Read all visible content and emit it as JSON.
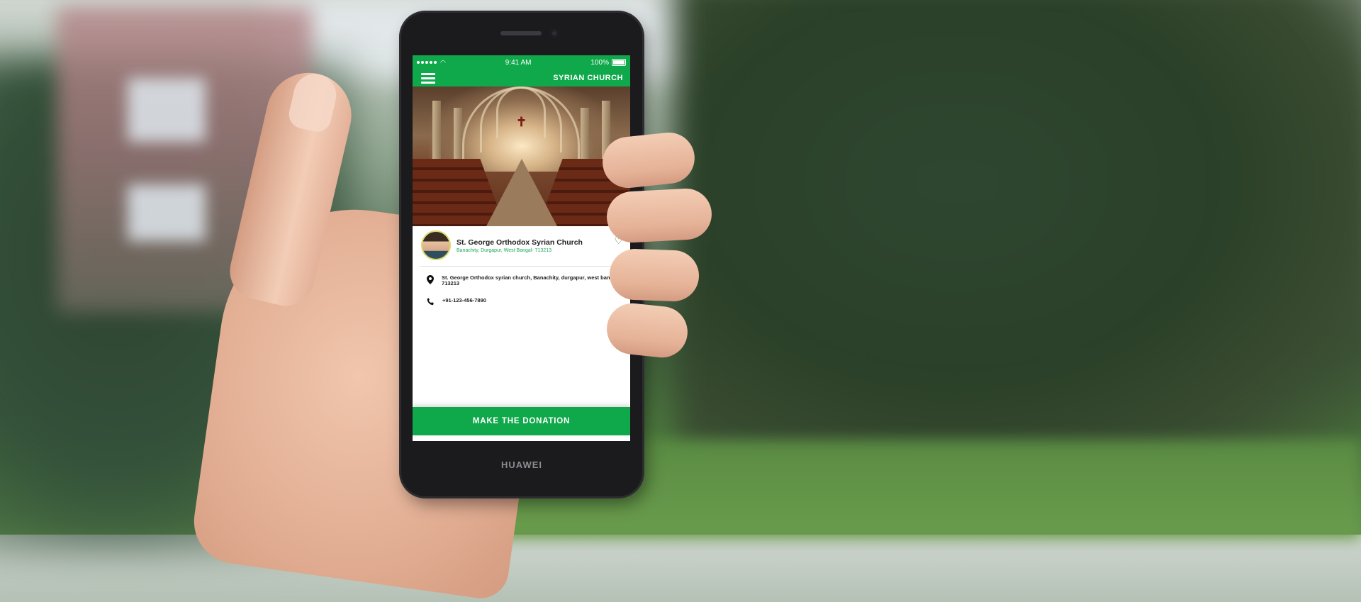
{
  "device": {
    "brand": "HUAWEI"
  },
  "status_bar": {
    "time": "9:41 AM",
    "battery": "100%"
  },
  "nav": {
    "title": "SYRIAN CHURCH"
  },
  "church": {
    "name": "St. George Orthodox Syrian Church",
    "location": "Banachity, Durgapur, West Bangal- 713213",
    "address": "St. George Orthodox syrian church, Banachity, durgapur, west bangal- 713213",
    "phone": "+91-123-456-7890"
  },
  "actions": {
    "donate_label": "MAKE THE DONATION"
  },
  "icons": {
    "menu": "menu-icon",
    "favorite": "heart-icon",
    "address": "location-pin-icon",
    "phone": "phone-icon"
  },
  "colors": {
    "accent": "#0fa84a"
  }
}
